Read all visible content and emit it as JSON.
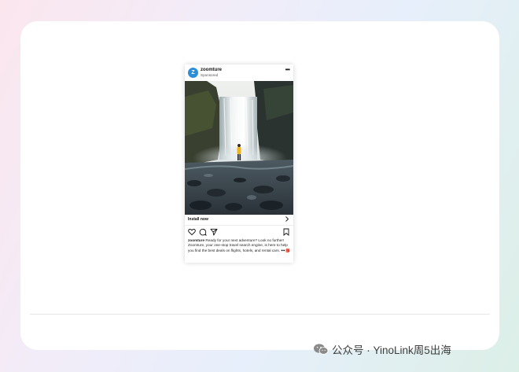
{
  "post": {
    "avatar_letter": "Z",
    "username": "zoomture",
    "sponsored": "Sponsored",
    "more": "•••",
    "install_label": "Install now",
    "caption_user": "zoomture",
    "caption_text": "Ready for your next adventure? Look no further! Zoomture, your one-stop travel search engine, is here to help you find the best deals on flights, hotels, and rental cars.",
    "caption_emoji": "🕶️🎒"
  },
  "watermark": {
    "text": "公众号 · YinoLink周5出海"
  },
  "icons": [
    "heart-icon",
    "comment-icon",
    "share-icon",
    "bookmark-icon",
    "chevron-right-icon",
    "wechat-icon"
  ]
}
